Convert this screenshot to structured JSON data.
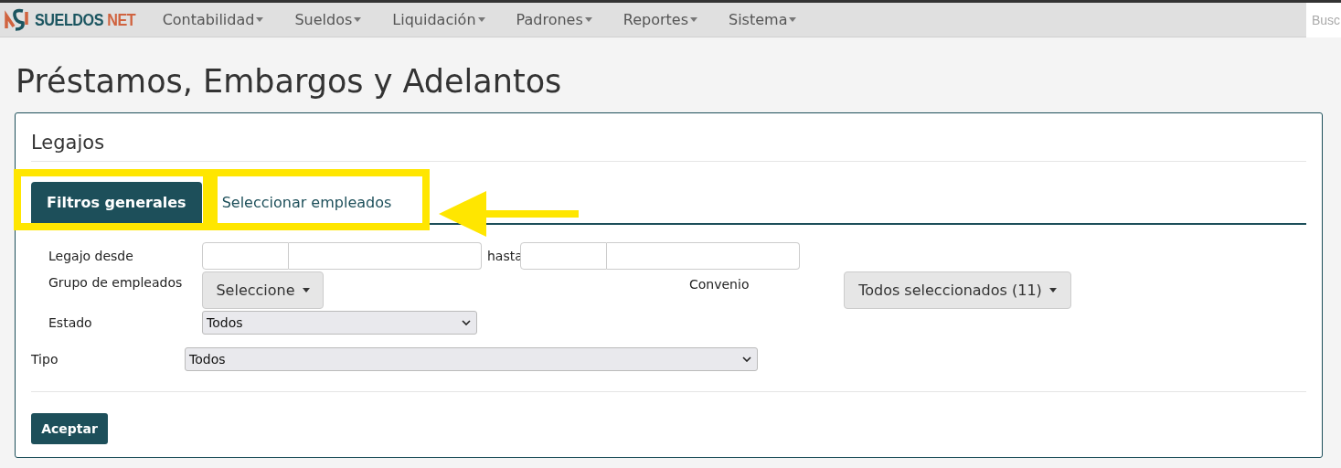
{
  "brand": {
    "first": "SUELDOS",
    "second": "NET"
  },
  "nav": [
    {
      "label": "Contabilidad"
    },
    {
      "label": "Sueldos"
    },
    {
      "label": "Liquidación"
    },
    {
      "label": "Padrones"
    },
    {
      "label": "Reportes"
    },
    {
      "label": "Sistema"
    }
  ],
  "search": {
    "placeholder": "Busc"
  },
  "page_title": "Préstamos, Embargos y Adelantos",
  "panel": {
    "title": "Legajos",
    "tabs": [
      {
        "label": "Filtros generales",
        "selected": true
      },
      {
        "label": "Seleccionar empleados",
        "selected": false
      }
    ],
    "legajo": {
      "label": "Legajo desde",
      "to_label": "hasta"
    },
    "grupo": {
      "label": "Grupo de empleados",
      "button": "Seleccione"
    },
    "convenio": {
      "label": "Convenio",
      "button": "Todos seleccionados (11)"
    },
    "estado": {
      "label": "Estado",
      "value": "Todos"
    },
    "tipo": {
      "label": "Tipo",
      "value": "Todos"
    },
    "submit": "Aceptar"
  }
}
